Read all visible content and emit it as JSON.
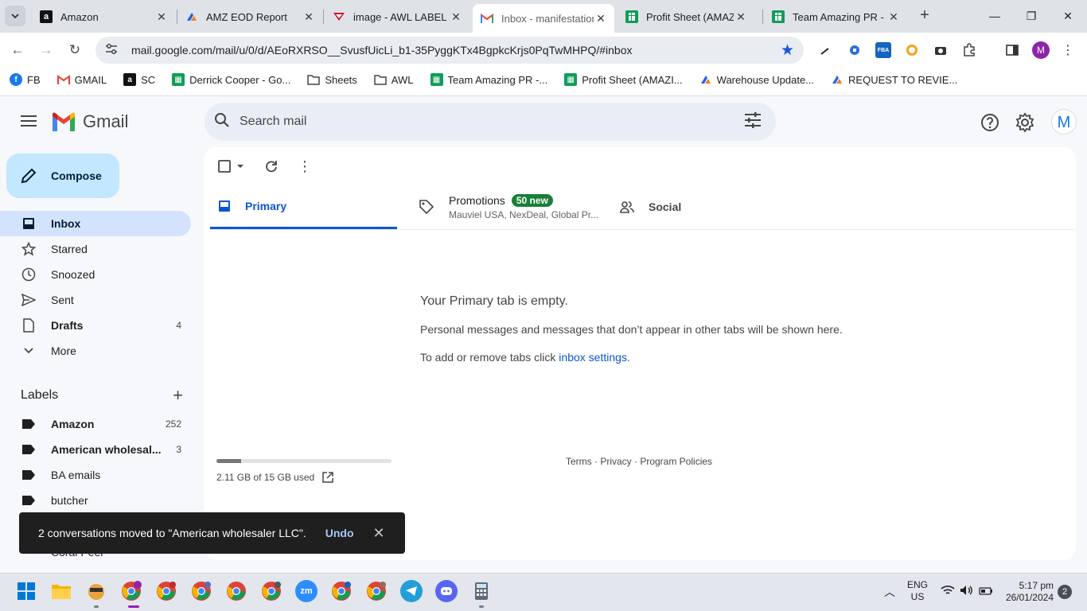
{
  "browser": {
    "tabs": [
      {
        "title": "Amazon",
        "favicon": "amazon-icon",
        "close": "✕"
      },
      {
        "title": "AMZ EOD Report",
        "favicon": "clickup-icon",
        "close": "✕"
      },
      {
        "title": "image - AWL LABEL",
        "favicon": "awl-icon",
        "close": "✕"
      },
      {
        "title": "Inbox - manifestation",
        "favicon": "gmail-icon",
        "close": "✕"
      },
      {
        "title": "Profit Sheet (AMAZIN",
        "favicon": "sheets-icon",
        "close": "✕"
      },
      {
        "title": "Team Amazing PR - G",
        "favicon": "sheets-icon",
        "close": "✕"
      }
    ],
    "new_tab": "+",
    "url": "mail.google.com/mail/u/0/d/AEoRXRSO__SvusfUicLi_b1-35PyggKTx4BgpkcKrjs0PqTwMHPQ/#inbox",
    "profile_initial": "M",
    "ext_fba": "FBA",
    "bookmarks": [
      {
        "label": "FB",
        "icon": "facebook-icon"
      },
      {
        "label": "GMAIL",
        "icon": "gmail-icon"
      },
      {
        "label": "SC",
        "icon": "amazon-icon"
      },
      {
        "label": "Derrick Cooper - Go...",
        "icon": "sheets-icon"
      },
      {
        "label": "Sheets",
        "icon": "folder-icon"
      },
      {
        "label": "AWL",
        "icon": "folder-icon"
      },
      {
        "label": "Team Amazing PR -...",
        "icon": "sheets-icon"
      },
      {
        "label": "Profit Sheet (AMAZI...",
        "icon": "sheets-icon"
      },
      {
        "label": "Warehouse Update...",
        "icon": "clickup-icon"
      },
      {
        "label": "REQUEST TO REVIE...",
        "icon": "clickup-icon"
      }
    ]
  },
  "gmail": {
    "logo_text": "Gmail",
    "search_placeholder": "Search mail",
    "avatar_initial": "M",
    "compose_label": "Compose",
    "nav": [
      {
        "label": "Inbox",
        "count": "",
        "icon": "inbox-icon",
        "active": true,
        "bold": true
      },
      {
        "label": "Starred",
        "count": "",
        "icon": "star-icon"
      },
      {
        "label": "Snoozed",
        "count": "",
        "icon": "clock-icon"
      },
      {
        "label": "Sent",
        "count": "",
        "icon": "send-icon"
      },
      {
        "label": "Drafts",
        "count": "4",
        "icon": "draft-icon",
        "bold": true
      },
      {
        "label": "More",
        "count": "",
        "icon": "chevron-down-icon"
      }
    ],
    "labels_title": "Labels",
    "labels": [
      {
        "label": "Amazon",
        "count": "252",
        "bold": true
      },
      {
        "label": "American wholesal...",
        "count": "3",
        "bold": true
      },
      {
        "label": "BA emails",
        "count": ""
      },
      {
        "label": "butcher",
        "count": ""
      }
    ],
    "hidden_label": "Coral Peel",
    "inbox_tabs": {
      "primary": "Primary",
      "promotions": "Promotions",
      "promotions_badge": "50 new",
      "promotions_senders": "Mauviel USA, NexDeal, Global Pr...",
      "social": "Social"
    },
    "empty": {
      "title": "Your Primary tab is empty.",
      "line1": "Personal messages and messages that don’t appear in other tabs will be shown here.",
      "line2_prefix": "To add or remove tabs click ",
      "line2_link": "inbox settings",
      "line2_suffix": "."
    },
    "storage": {
      "used_text": "2.11 GB of 15 GB used",
      "fraction": 0.14
    },
    "footer": "Terms · Privacy · Program Policies",
    "snackbar": {
      "message": "2 conversations moved to \"American wholesaler LLC\".",
      "undo": "Undo",
      "close": "✕"
    }
  },
  "taskbar": {
    "zoom_label": "zm",
    "lang_line1": "ENG",
    "lang_line2": "US",
    "time": "5:17 pm",
    "date": "26/01/2024",
    "notifications": "2"
  },
  "colors": {
    "accent": "#0b57d0",
    "compose_bg": "#c2e7ff",
    "active_nav": "#d3e3fd",
    "promo_badge": "#188038"
  }
}
